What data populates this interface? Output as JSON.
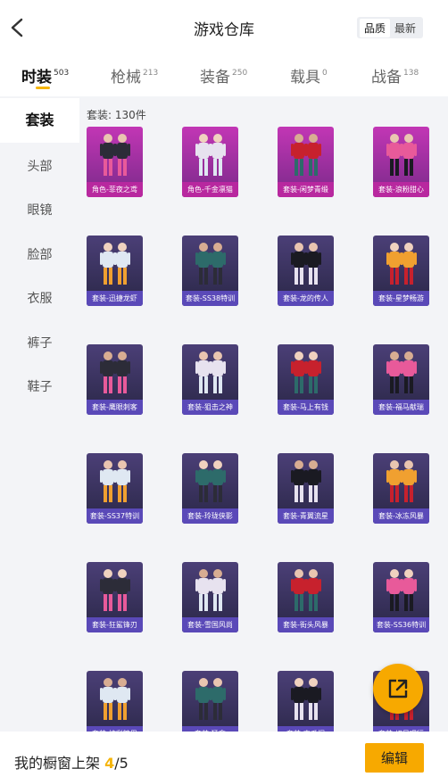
{
  "header": {
    "title": "游戏仓库",
    "sort_options": [
      "品质",
      "最新"
    ]
  },
  "tabs": [
    {
      "label": "时装",
      "count": "503"
    },
    {
      "label": "枪械",
      "count": "213"
    },
    {
      "label": "装备",
      "count": "250"
    },
    {
      "label": "载具",
      "count": "0"
    },
    {
      "label": "战备",
      "count": "138"
    }
  ],
  "sidebar": [
    "套装",
    "头部",
    "眼镜",
    "脸部",
    "衣服",
    "裤子",
    "鞋子"
  ],
  "grid": {
    "count_text": "套装: 130件",
    "items": [
      {
        "name": "角色-菲夜之鸢",
        "rarity": "legendary"
      },
      {
        "name": "角色-千金凛猫",
        "rarity": "legendary"
      },
      {
        "name": "套装-闲梦青缎",
        "rarity": "legendary"
      },
      {
        "name": "套装-浪粉甜心",
        "rarity": "legendary"
      },
      {
        "name": "套装-迅捷龙虾",
        "rarity": "epic"
      },
      {
        "name": "套装-SS38特训",
        "rarity": "epic"
      },
      {
        "name": "套装-龙的传人",
        "rarity": "epic"
      },
      {
        "name": "套装-星梦畅游",
        "rarity": "epic"
      },
      {
        "name": "套装-鹰眼刺客",
        "rarity": "epic"
      },
      {
        "name": "套装-狙击之神",
        "rarity": "epic"
      },
      {
        "name": "套装-马上有钱",
        "rarity": "epic"
      },
      {
        "name": "套装-福马献瑞",
        "rarity": "epic"
      },
      {
        "name": "套装-SS37特训",
        "rarity": "epic"
      },
      {
        "name": "套装-玲珑侠影",
        "rarity": "epic"
      },
      {
        "name": "套装-青翼流星",
        "rarity": "epic"
      },
      {
        "name": "套装-冰冻风暴",
        "rarity": "epic"
      },
      {
        "name": "套装-狂鲨锋刃",
        "rarity": "epic"
      },
      {
        "name": "套装-雪国风尚",
        "rarity": "epic"
      },
      {
        "name": "套装-街头风暴",
        "rarity": "epic"
      },
      {
        "name": "套装-SS36特训",
        "rarity": "epic"
      },
      {
        "name": "套装-炫彩糖果",
        "rarity": "epic"
      },
      {
        "name": "套装-猛禽",
        "rarity": "epic"
      },
      {
        "name": "套装-南瓜探",
        "rarity": "epic"
      },
      {
        "name": "套装-切日嘿行",
        "rarity": "epic"
      }
    ]
  },
  "colors": {
    "accent": "#f7a900",
    "legendary": "#c236b5",
    "epic": "#4b3f77"
  },
  "bottom": {
    "showcase_label": "我的橱窗上架",
    "current": "4",
    "total": "/5",
    "edit_label": "编辑"
  },
  "icons": {
    "back": "chevron-left-icon",
    "share": "share-icon"
  }
}
